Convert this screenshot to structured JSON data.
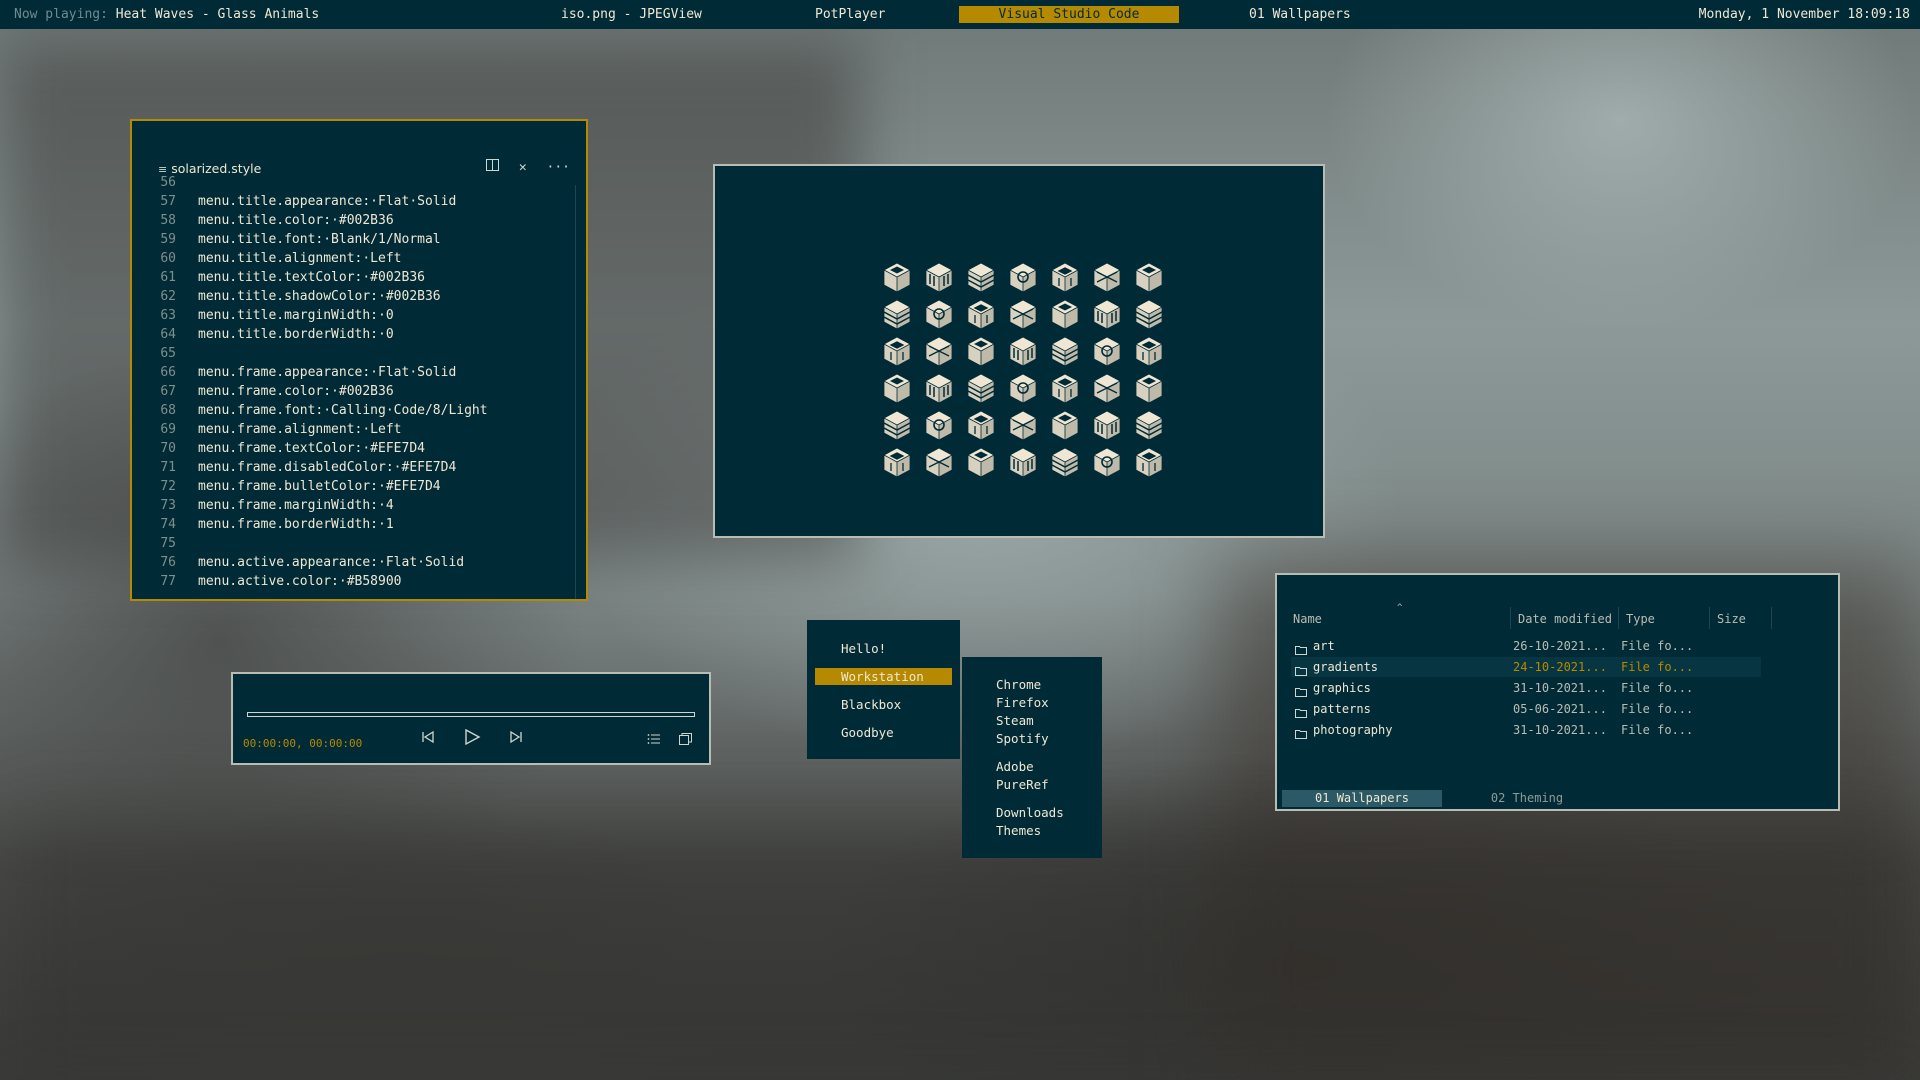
{
  "topbar": {
    "now_playing_label": "Now playing:",
    "now_playing_track": "Heat Waves - Glass Animals",
    "tasks": [
      "iso.png - JPEGView",
      "PotPlayer",
      "Visual Studio Code",
      "01 Wallpapers"
    ],
    "active_task": "Visual Studio Code",
    "clock": "Monday, 1 November 18:09:18"
  },
  "editor": {
    "tab_title": "solarized.style",
    "lines": [
      {
        "n": "56",
        "t": ""
      },
      {
        "n": "57",
        "t": "menu.title.appearance:·Flat·Solid"
      },
      {
        "n": "58",
        "t": "menu.title.color:·#002B36"
      },
      {
        "n": "59",
        "t": "menu.title.font:·Blank/1/Normal"
      },
      {
        "n": "60",
        "t": "menu.title.alignment:·Left"
      },
      {
        "n": "61",
        "t": "menu.title.textColor:·#002B36"
      },
      {
        "n": "62",
        "t": "menu.title.shadowColor:·#002B36"
      },
      {
        "n": "63",
        "t": "menu.title.marginWidth:·0"
      },
      {
        "n": "64",
        "t": "menu.title.borderWidth:·0"
      },
      {
        "n": "65",
        "t": ""
      },
      {
        "n": "66",
        "t": "menu.frame.appearance:·Flat·Solid"
      },
      {
        "n": "67",
        "t": "menu.frame.color:·#002B36"
      },
      {
        "n": "68",
        "t": "menu.frame.font:·Calling·Code/8/Light"
      },
      {
        "n": "69",
        "t": "menu.frame.alignment:·Left"
      },
      {
        "n": "70",
        "t": "menu.frame.textColor:·#EFE7D4"
      },
      {
        "n": "71",
        "t": "menu.frame.disabledColor:·#EFE7D4"
      },
      {
        "n": "72",
        "t": "menu.frame.bulletColor:·#EFE7D4"
      },
      {
        "n": "73",
        "t": "menu.frame.marginWidth:·4"
      },
      {
        "n": "74",
        "t": "menu.frame.borderWidth:·1"
      },
      {
        "n": "75",
        "t": ""
      },
      {
        "n": "76",
        "t": "menu.active.appearance:·Flat·Solid"
      },
      {
        "n": "77",
        "t": "menu.active.color:·#B58900"
      }
    ]
  },
  "player": {
    "time": "00:00:00, 00:00:00",
    "progress": 0
  },
  "menu": {
    "items": [
      "Hello!",
      "Workstation",
      "Blackbox",
      "Goodbye"
    ],
    "active": "Workstation",
    "submenu": [
      "Chrome",
      "Firefox",
      "Steam",
      "Spotify",
      "Adobe",
      "PureRef",
      "Downloads",
      "Themes"
    ]
  },
  "files": {
    "columns": [
      "Name",
      "Date modified",
      "Type",
      "Size"
    ],
    "rows": [
      {
        "name": "art",
        "date": "26-10-2021...",
        "type": "File fo...",
        "selected": false
      },
      {
        "name": "gradients",
        "date": "24-10-2021...",
        "type": "File fo...",
        "selected": true
      },
      {
        "name": "graphics",
        "date": "31-10-2021...",
        "type": "File fo...",
        "selected": false
      },
      {
        "name": "patterns",
        "date": "05-06-2021...",
        "type": "File fo...",
        "selected": false
      },
      {
        "name": "photography",
        "date": "31-10-2021...",
        "type": "File fo...",
        "selected": false
      }
    ],
    "tabs": [
      "01 Wallpapers",
      "02 Theming"
    ],
    "active_tab": "01 Wallpapers"
  },
  "colors": {
    "base03": "#002B36",
    "base3": "#EFE7D4",
    "yellow": "#B58900"
  },
  "viewer": {
    "icon_name": "isometric-cube-icon",
    "icon_count": 42
  }
}
